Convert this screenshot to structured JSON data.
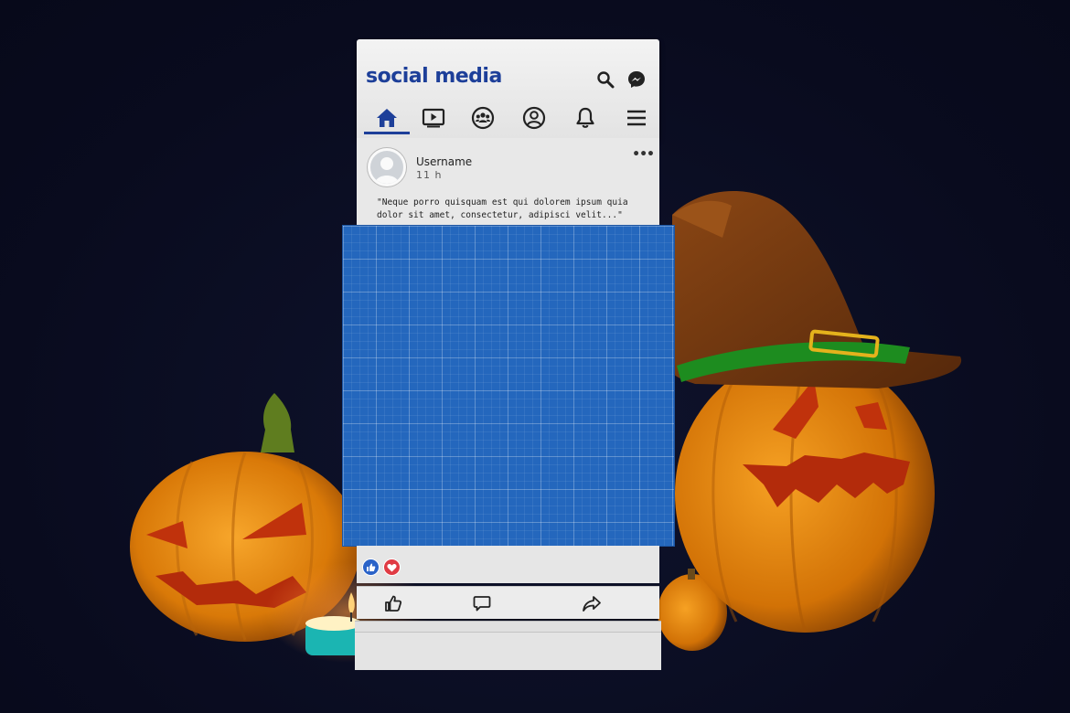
{
  "app": {
    "title": "social media"
  },
  "header_actions": [
    {
      "name": "search-icon"
    },
    {
      "name": "messenger-icon"
    }
  ],
  "nav": {
    "items": [
      {
        "name": "home-icon",
        "active": true
      },
      {
        "name": "video-icon",
        "active": false
      },
      {
        "name": "groups-icon",
        "active": false
      },
      {
        "name": "profile-icon",
        "active": false
      },
      {
        "name": "notifications-icon",
        "active": false
      },
      {
        "name": "menu-icon",
        "active": false
      }
    ]
  },
  "post": {
    "username": "Username",
    "time": "11 h",
    "more": "•••",
    "text": "\"Neque porro quisquam est qui dolorem ipsum quia dolor sit amet, consectetur, adipisci velit...\"",
    "reactions": [
      "like-reaction-icon",
      "love-reaction-icon"
    ],
    "actions": [
      "like-icon",
      "comment-icon",
      "share-icon"
    ]
  },
  "colors": {
    "brand": "#1d3f99",
    "image_placeholder": "#2467bd",
    "background": "#0a0d23",
    "pumpkin": "#e98a10",
    "hat": "#6b3510",
    "hat_band": "#1d8c1f",
    "love": "#e03b44",
    "like": "#2b63c8"
  }
}
